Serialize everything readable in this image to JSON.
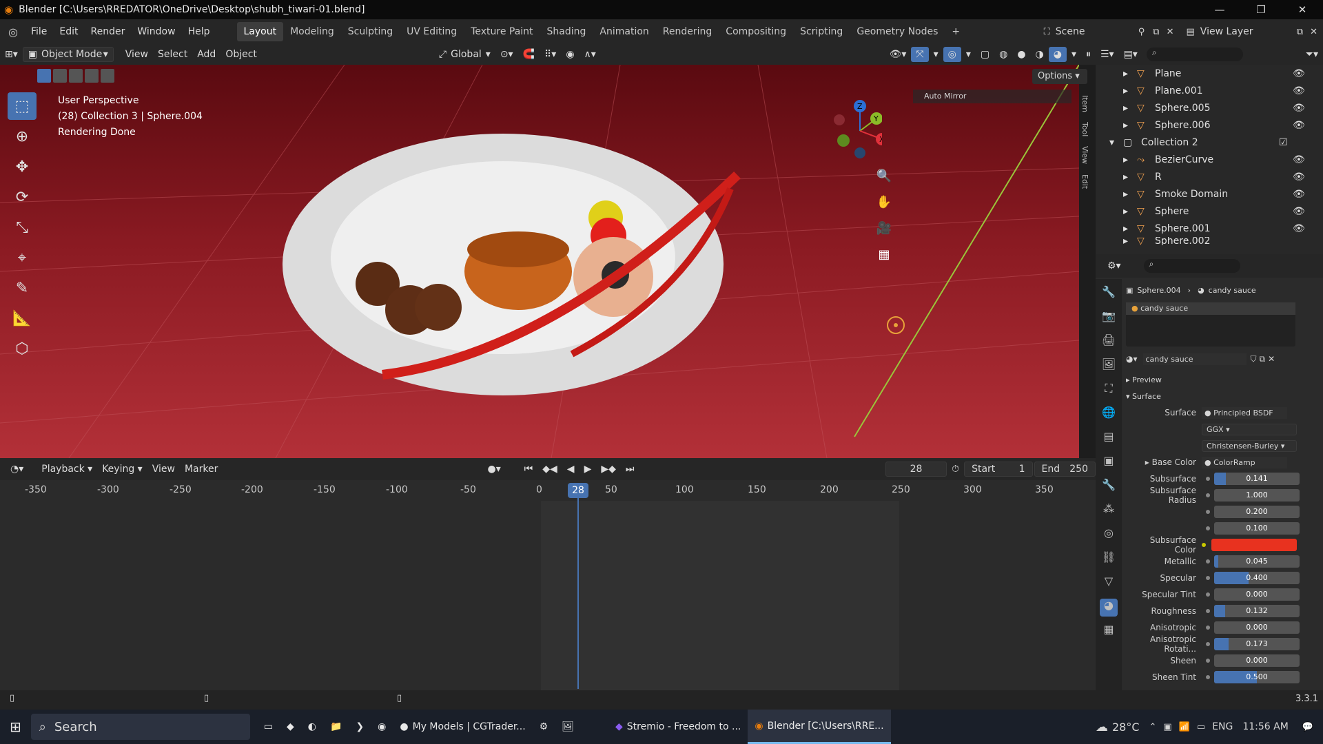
{
  "window": {
    "title": "Blender [C:\\Users\\RREDATOR\\OneDrive\\Desktop\\shubh_tiwari-01.blend]"
  },
  "menu": [
    "File",
    "Edit",
    "Render",
    "Window",
    "Help"
  ],
  "workspaces": [
    "Layout",
    "Modeling",
    "Sculpting",
    "UV Editing",
    "Texture Paint",
    "Shading",
    "Animation",
    "Rendering",
    "Compositing",
    "Scripting",
    "Geometry Nodes"
  ],
  "scene": {
    "name": "Scene",
    "view_layer": "View Layer"
  },
  "header": {
    "mode": "Object Mode",
    "menus": [
      "View",
      "Select",
      "Add",
      "Object"
    ],
    "orientation": "Global",
    "options": "Options"
  },
  "viewport": {
    "perspective": "User Perspective",
    "collection_info": "(28) Collection 3 | Sphere.004",
    "status": "Rendering Done",
    "auto_mirror": "Auto Mirror",
    "side_tabs": [
      "Item",
      "Tool",
      "View",
      "Edit"
    ]
  },
  "timeline": {
    "menus": [
      "Playback",
      "Keying",
      "View",
      "Marker"
    ],
    "current_frame": "28",
    "start_label": "Start",
    "start": "1",
    "end_label": "End",
    "end": "250",
    "ticks": [
      "-350",
      "-300",
      "-250",
      "-200",
      "-150",
      "-100",
      "-50",
      "0",
      "50",
      "100",
      "150",
      "200",
      "250",
      "300",
      "350"
    ],
    "playhead": "28"
  },
  "outliner": {
    "rows": [
      {
        "name": "Plane"
      },
      {
        "name": "Plane.001"
      },
      {
        "name": "Sphere.005"
      },
      {
        "name": "Sphere.006"
      },
      {
        "name": "Collection 2"
      },
      {
        "name": "BezierCurve"
      },
      {
        "name": "R"
      },
      {
        "name": "Smoke Domain"
      },
      {
        "name": "Sphere"
      },
      {
        "name": "Sphere.001"
      },
      {
        "name": "Sphere.002"
      }
    ]
  },
  "properties": {
    "breadcrumb_object": "Sphere.004",
    "breadcrumb_material": "candy sauce",
    "slot": "candy sauce",
    "material_name": "candy sauce",
    "preview_label": "Preview",
    "surface_section": "Surface",
    "surface_label": "Surface",
    "surface_value": "Principled BSDF",
    "distribution": "GGX",
    "subsurface_method": "Christensen-Burley",
    "base_color_label": "Base Color",
    "base_color_value": "ColorRamp",
    "subsurface_color_label": "Subsurface Color",
    "subsurface_color": "#e8321f",
    "fields": [
      {
        "label": "Subsurface",
        "value": "0.141",
        "frac": 0.141
      },
      {
        "label": "Subsurface Radius",
        "value": "1.000",
        "frac": 0
      },
      {
        "label": "",
        "value": "0.200",
        "frac": 0
      },
      {
        "label": "",
        "value": "0.100",
        "frac": 0
      },
      {
        "label": "Metallic",
        "value": "0.045",
        "frac": 0.045
      },
      {
        "label": "Specular",
        "value": "0.400",
        "frac": 0.4
      },
      {
        "label": "Specular Tint",
        "value": "0.000",
        "frac": 0
      },
      {
        "label": "Roughness",
        "value": "0.132",
        "frac": 0.132
      },
      {
        "label": "Anisotropic",
        "value": "0.000",
        "frac": 0
      },
      {
        "label": "Anisotropic Rotati...",
        "value": "0.173",
        "frac": 0.173
      },
      {
        "label": "Sheen",
        "value": "0.000",
        "frac": 0
      },
      {
        "label": "Sheen Tint",
        "value": "0.500",
        "frac": 0.5
      }
    ]
  },
  "status_bar": {
    "version": "3.3.1"
  },
  "taskbar": {
    "search": "Search",
    "apps": [
      "My Models | CGTrader...",
      "Stremio - Freedom to ...",
      "Blender [C:\\Users\\RRE..."
    ],
    "weather": "28°C",
    "lang": "ENG",
    "time": "11:56 AM"
  },
  "colors": {
    "accent": "#4773b1",
    "viewport_red": "#9b2028"
  }
}
